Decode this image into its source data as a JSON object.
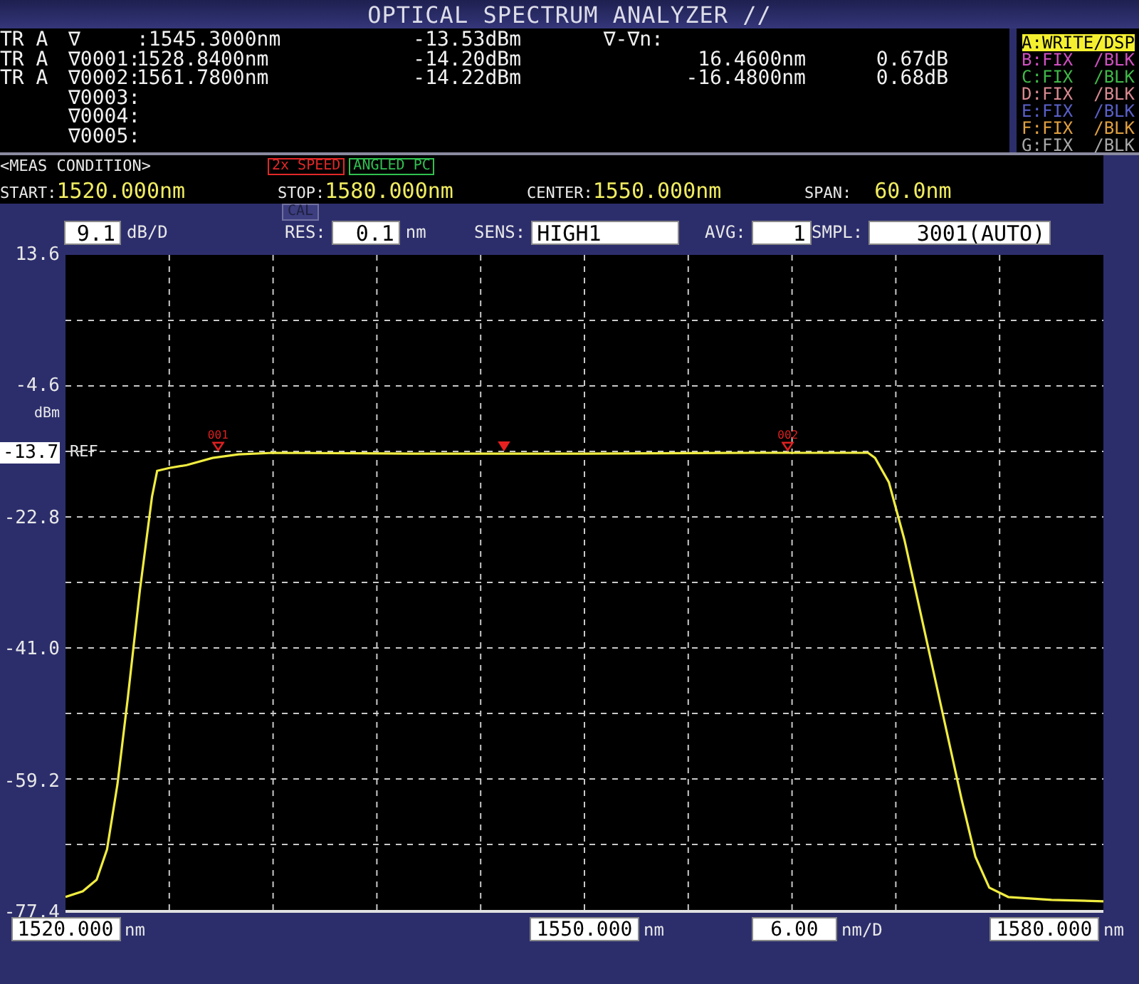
{
  "window": {
    "title": "OPTICAL SPECTRUM ANALYZER //"
  },
  "marker_table": {
    "rows": [
      {
        "trace": "TR A",
        "marker": "∇",
        "wavelength": ":1545.3000nm",
        "power": "-13.53dBm"
      },
      {
        "trace": "TR A",
        "marker": "∇0001:",
        "wavelength": "1528.8400nm",
        "power": "-14.20dBm"
      },
      {
        "trace": "TR A",
        "marker": "∇0002:",
        "wavelength": "1561.7800nm",
        "power": "-14.22dBm"
      },
      {
        "marker": "∇0003:"
      },
      {
        "marker": "∇0004:"
      },
      {
        "marker": "∇0005:"
      }
    ],
    "delta_heading": "∇-∇n:",
    "deltas": [
      {
        "wavelength": "16.4600nm",
        "power": "0.67dB"
      },
      {
        "wavelength": "-16.4800nm",
        "power": "0.68dB"
      }
    ]
  },
  "traces": [
    {
      "label": "A:WRITE",
      "mode": "/DSP",
      "selected": true,
      "color": "#f4f030"
    },
    {
      "label": "B:FIX",
      "mode": "/BLK",
      "selected": false,
      "color": "#d050c0"
    },
    {
      "label": "C:FIX",
      "mode": "/BLK",
      "selected": false,
      "color": "#40b848"
    },
    {
      "label": "D:FIX",
      "mode": "/BLK",
      "selected": false,
      "color": "#d88a90"
    },
    {
      "label": "E:FIX",
      "mode": "/BLK",
      "selected": false,
      "color": "#5a60c8"
    },
    {
      "label": "F:FIX",
      "mode": "/BLK",
      "selected": false,
      "color": "#e0a040"
    },
    {
      "label": "G:FIX",
      "mode": "/BLK",
      "selected": false,
      "color": "#a8a8a8"
    }
  ],
  "meas_condition": {
    "heading": "<MEAS CONDITION>",
    "badges": [
      {
        "text": "2x SPEED",
        "color": "#e02828"
      },
      {
        "text": "ANGLED PC",
        "color": "#30c050"
      }
    ],
    "params": [
      {
        "label": "START:",
        "value": "1520.000nm"
      },
      {
        "label": "STOP:",
        "value": "1580.000nm"
      },
      {
        "label": "CENTER:",
        "value": "1550.000nm"
      },
      {
        "label": "SPAN:",
        "value": "60.0nm"
      }
    ]
  },
  "settings": {
    "scale": {
      "value": "9.1",
      "unit": "dB/D"
    },
    "cal": "CAL",
    "res": {
      "label": "RES:",
      "value": "0.1",
      "unit": "nm"
    },
    "sens": {
      "label": "SENS:",
      "value": "HIGH1"
    },
    "avg": {
      "label": "AVG:",
      "value": "1"
    },
    "smpl": {
      "label": "SMPL:",
      "value": "3001(AUTO)"
    }
  },
  "plot": {
    "chart_data": {
      "type": "line",
      "ylabel": "dBm",
      "x": [
        1520,
        1521,
        1521.8,
        1522.4,
        1523,
        1523.6,
        1524.3,
        1525,
        1525.3,
        1526,
        1527,
        1528.5,
        1530,
        1532,
        1540,
        1550,
        1560,
        1566.4,
        1566.8,
        1567.6,
        1568.5,
        1569.6,
        1570.7,
        1571.8,
        1572.6,
        1573.4,
        1574.5,
        1577,
        1580
      ],
      "series": [
        {
          "color": "#f0ec40",
          "values": [
            -75.6,
            -74.8,
            -73.2,
            -69,
            -60,
            -48,
            -33,
            -20,
            -16.4,
            -16,
            -15.6,
            -14.6,
            -14.1,
            -13.9,
            -14,
            -14,
            -13.9,
            -13.9,
            -14.6,
            -18,
            -26,
            -38,
            -50,
            -62,
            -70,
            -74.3,
            -75.6,
            -76,
            -76.2
          ]
        }
      ],
      "xlim": [
        1520,
        1580
      ],
      "ylim": [
        -77.4,
        13.6
      ],
      "grid": true,
      "xticks": [
        {
          "value": 1520,
          "label": "1520.000"
        },
        {
          "value": 1550,
          "label": "1550.000"
        }
      ],
      "yticks": [
        {
          "value": 13.6,
          "label": "13.6"
        },
        {
          "value": -4.6,
          "label": "-4.6"
        },
        {
          "value": -22.8,
          "label": "-22.8"
        },
        {
          "value": -41,
          "label": "-41.0"
        },
        {
          "value": -59.2,
          "label": "-59.2"
        },
        {
          "value": -77.4,
          "label": "-77.4"
        }
      ]
    },
    "ref": {
      "value": "-13.7",
      "label": "REF"
    },
    "markers": [
      {
        "kind": "numbered",
        "label": "001"
      },
      {
        "kind": "center"
      },
      {
        "kind": "numbered",
        "label": "002"
      }
    ]
  },
  "x_axis": {
    "start": {
      "unit": "nm"
    },
    "center": {
      "unit": "nm"
    },
    "scale": {
      "value": "6.00",
      "unit": "nm/D"
    },
    "stop": {
      "value": "1580.000",
      "unit": "nm"
    }
  }
}
